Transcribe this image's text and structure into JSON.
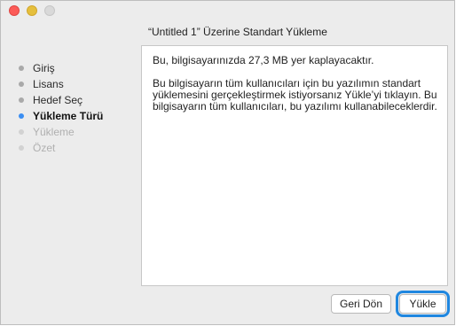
{
  "window": {
    "controls": [
      "close",
      "minimize",
      "zoom"
    ]
  },
  "heading": "“Untitled 1” Üzerine Standart Yükleme",
  "steps": [
    {
      "label": "Giriş",
      "state": "done"
    },
    {
      "label": "Lisans",
      "state": "done"
    },
    {
      "label": "Hedef Seç",
      "state": "done"
    },
    {
      "label": "Yükleme Türü",
      "state": "current"
    },
    {
      "label": "Yükleme",
      "state": "pending"
    },
    {
      "label": "Özet",
      "state": "pending"
    }
  ],
  "content": {
    "paragraph1": "Bu, bilgisayarınızda 27,3 MB yer kaplayacaktır.",
    "paragraph2": "Bu bilgisayarın tüm kullanıcıları için bu yazılımın standart yüklemesini gerçekleştirmek istiyorsanız Yükle’yi tıklayın. Bu bilgisayarın tüm kullanıcıları, bu yazılımı kullanabileceklerdir."
  },
  "buttons": {
    "back": "Geri Dön",
    "install": "Yükle"
  },
  "colors": {
    "current_step_dot": "#3b8ef2",
    "focus_ring": "#1f87e0",
    "close": "#fc5b57",
    "minimize": "#e5bf3c"
  }
}
